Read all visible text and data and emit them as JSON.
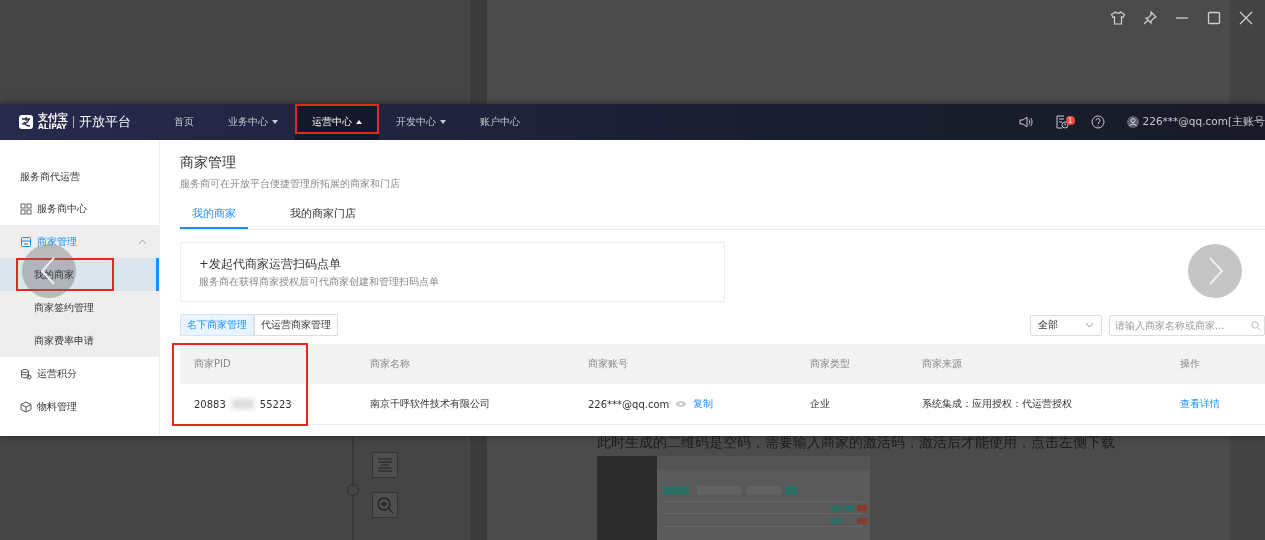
{
  "screenshot": {
    "logo": {
      "brand": "支付宝",
      "brand_sub": "ALIPAY",
      "product": "开放平台"
    },
    "nav": [
      {
        "label": "首页",
        "dropdown": false,
        "selected": false,
        "annotated": false
      },
      {
        "label": "业务中心",
        "dropdown": true,
        "selected": false,
        "annotated": false
      },
      {
        "label": "运营中心",
        "dropdown": true,
        "selected": true,
        "annotated": true
      },
      {
        "label": "开发中心",
        "dropdown": true,
        "selected": false,
        "annotated": false
      },
      {
        "label": "账户中心",
        "dropdown": false,
        "selected": false,
        "annotated": false
      }
    ],
    "notification_badge": "1",
    "user": "226***@qq.com[主账号",
    "sidebar": {
      "heading": "服务商代运营",
      "items": [
        {
          "label": "服务商中心",
          "selected": false,
          "expanded": false
        },
        {
          "label": "商家管理",
          "selected": true,
          "expanded": true,
          "children": [
            {
              "label": "我的商家",
              "selected": true,
              "annotated": true
            },
            {
              "label": "商家签约管理",
              "selected": false,
              "annotated": false
            },
            {
              "label": "商家费率申请",
              "selected": false,
              "annotated": false
            }
          ]
        },
        {
          "label": "运营积分",
          "selected": false,
          "expanded": false
        },
        {
          "label": "物料管理",
          "selected": false,
          "expanded": false
        }
      ]
    },
    "page": {
      "title": "商家管理",
      "subtitle": "服务商可在开放平台便捷管理所拓展的商家和门店",
      "tabs": [
        {
          "label": "我的商家",
          "selected": true
        },
        {
          "label": "我的商家门店",
          "selected": false
        }
      ],
      "action_card": {
        "title": "+发起代商家运营扫码点单",
        "description": "服务商在获得商家授权后可代商家创建和管理扫码点单"
      },
      "segments": [
        {
          "label": "名下商家管理",
          "selected": true
        },
        {
          "label": "代运营商家管理",
          "selected": false
        }
      ],
      "filter": {
        "value": "全部"
      },
      "search": {
        "placeholder": "请输入商家名称或商家..."
      },
      "table": {
        "columns": [
          {
            "label": "商家PID",
            "annotated": true
          },
          {
            "label": "商家名称",
            "annotated": false
          },
          {
            "label": "商家账号",
            "annotated": false
          },
          {
            "label": "商家类型",
            "annotated": false
          },
          {
            "label": "商家来源",
            "annotated": false
          },
          {
            "label": "操作",
            "annotated": false
          }
        ],
        "rows": [
          {
            "pid_start": "20883",
            "pid_end": "55223",
            "name": "南京千呼软件技术有限公司",
            "account": "226***@qq.com",
            "copy": "复制",
            "type": "企业",
            "source": "系统集成：应用授权：代运营授权",
            "action": "查看详情"
          }
        ]
      }
    }
  },
  "document": {
    "paragraph": "此时生成的二维码是空码，需要输入商家的激活码，激活后才能使用，点击左侧下载"
  }
}
